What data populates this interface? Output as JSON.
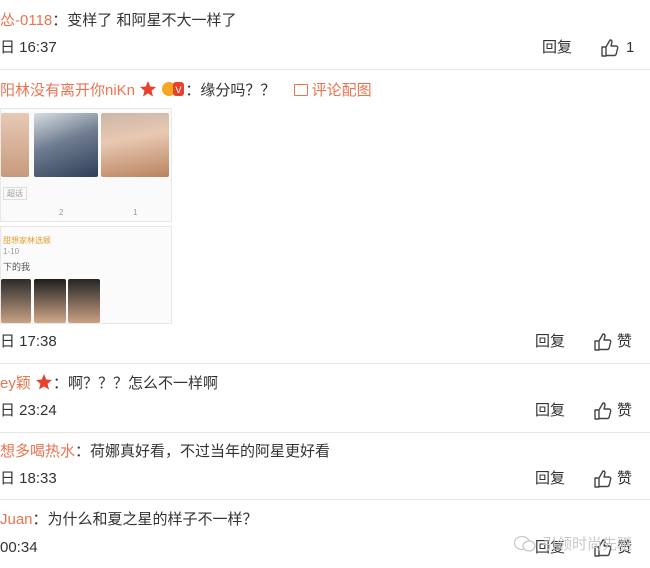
{
  "actions": {
    "reply_label": "回复",
    "like_label": "赞"
  },
  "comments": [
    {
      "user": "怂-0118",
      "sep": "：",
      "text": "变样了  和阿星不大一样了",
      "time": "日 16:37",
      "reply": "回复",
      "likes": "1"
    },
    {
      "user": "阳林没有离开你niKn",
      "sep": "：",
      "text": "缘分吗？？",
      "pic_link": "评论配图",
      "time": "日 17:38",
      "reply": "回复",
      "likes": "赞",
      "embedded": {
        "tag": "超话",
        "counts": [
          "2",
          "1"
        ],
        "card2_name": "甜想家林选颖",
        "card2_meta": "1-10",
        "card2_caption": "下的我"
      }
    },
    {
      "user": "ey颖",
      "sep": "：",
      "text": "啊？？？怎么不一样啊",
      "time": "日 23:24",
      "reply": "回复",
      "likes": "赞"
    },
    {
      "user": "想多喝热水",
      "sep": "：",
      "text": "荷娜真好看，不过当年的阿星更好看",
      "time": "日 18:33",
      "reply": "回复",
      "likes": "赞"
    },
    {
      "user": "Juan",
      "sep": "：",
      "text": "为什么和夏之星的样子不一样？",
      "time": "00:34",
      "reply": "回复",
      "likes": "赞"
    }
  ],
  "watermark": "引领时尚先驱",
  "colors": {
    "username": "#eb7350",
    "divider": "#e6e6e6",
    "text": "#333333"
  }
}
